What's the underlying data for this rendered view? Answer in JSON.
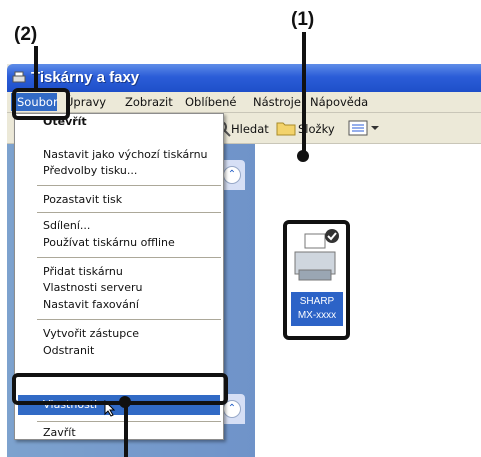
{
  "callouts": {
    "c1": "(1)",
    "c2": "(2)"
  },
  "window": {
    "title": "Tiskárny a faxy"
  },
  "menubar": {
    "items": [
      "Soubor",
      "Úpravy",
      "Zobrazit",
      "Oblíbené",
      "Nástroje",
      "Nápověda"
    ]
  },
  "toolbar": {
    "search": "Hledat",
    "folders": "Složky"
  },
  "file_menu": {
    "header": "Otevřít",
    "items": [
      "Nastavit jako výchozí tiskárnu",
      "Předvolby tisku...",
      "Pozastavit tisk",
      "Sdílení...",
      "Používat tiskárnu offline",
      "Přidat tiskárnu",
      "Vlastnosti serveru",
      "Nastavit faxování",
      "Vytvořit zástupce",
      "Odstranit",
      "Vlastnosti",
      "Zavřít"
    ]
  },
  "printer": {
    "brand": "SHARP",
    "model": "MX-xxxx"
  },
  "colors": {
    "titlebar": "#2b5dd8",
    "highlight": "#316ac5",
    "callout": "#111111"
  }
}
